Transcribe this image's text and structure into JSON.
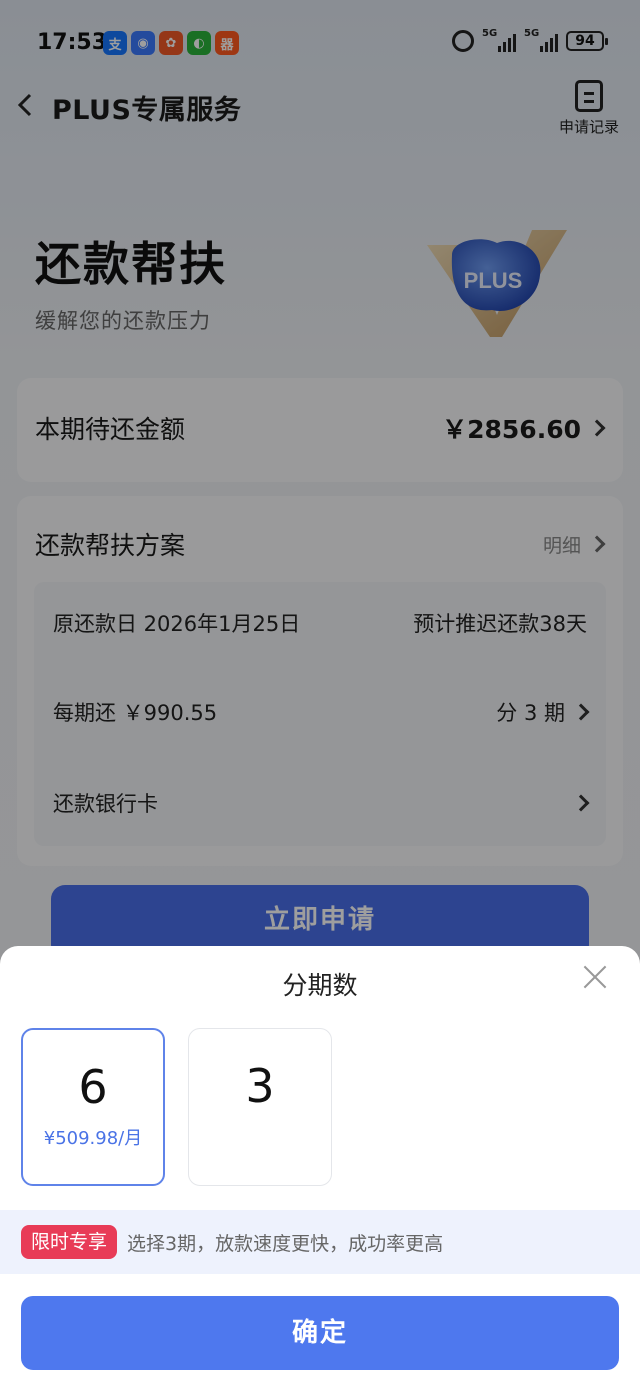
{
  "status_bar": {
    "time": "17:53",
    "app_icons": [
      {
        "name": "alipay-icon",
        "glyph": "支",
        "color": "#1677ff"
      },
      {
        "name": "app-icon-2",
        "glyph": "◉",
        "color": "#3a7afe"
      },
      {
        "name": "app-icon-3",
        "glyph": "✿",
        "color": "#f05a28"
      },
      {
        "name": "wechat-icon",
        "glyph": "◐",
        "color": "#2ab33a"
      },
      {
        "name": "app-icon-5",
        "glyph": "器",
        "color": "#ff5a1f"
      }
    ],
    "signal1_label": "5G",
    "signal2_label": "5G",
    "battery": "94"
  },
  "nav": {
    "title": "PLUS专属服务",
    "record_label": "申请记录"
  },
  "hero": {
    "title": "还款帮扶",
    "subtitle": "缓解您的还款压力",
    "badge_text": "PLUS"
  },
  "due_card": {
    "label": "本期待还金额",
    "amount": "￥2856.60"
  },
  "plan_card": {
    "title": "还款帮扶方案",
    "detail_label": "明细",
    "original_date_label": "原还款日 2026年1月25日",
    "postpone_text": "预计推迟还款38天",
    "per_period_label": "每期还 ￥990.55",
    "installments_text": "分 3 期",
    "bank_card_label": "还款银行卡"
  },
  "apply_button": "立即申请",
  "sheet": {
    "title": "分期数",
    "options": [
      {
        "num": "6",
        "sub": "¥509.98/月",
        "selected": true
      },
      {
        "num": "3",
        "sub": "",
        "selected": false
      }
    ],
    "promo_tag": "限时专享",
    "promo_text": "选择3期，放款速度更快，成功率更高",
    "confirm": "确定"
  },
  "colors": {
    "primary": "#4e78ee",
    "promo_tag": "#e83b57",
    "selected_border": "#5f83e9"
  }
}
